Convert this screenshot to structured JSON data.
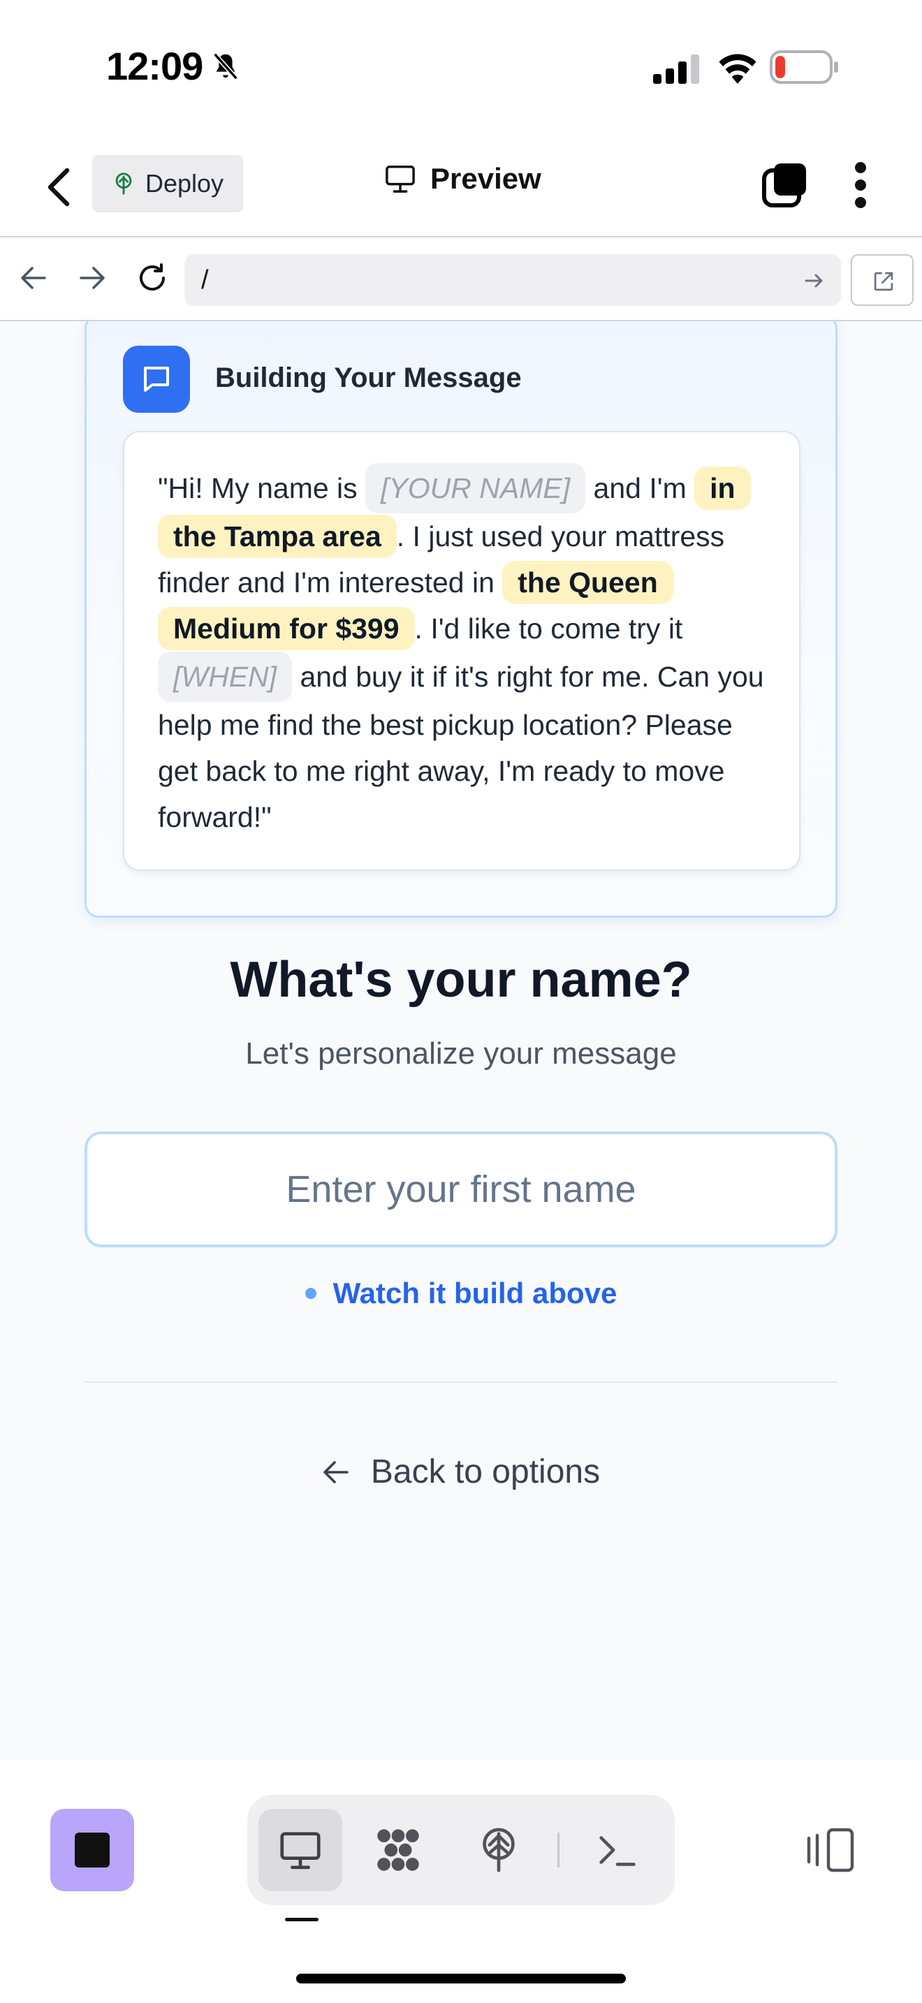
{
  "status_bar": {
    "time": "12:09",
    "battery_level": 0.18
  },
  "header": {
    "deploy_label": "Deploy",
    "title": "Preview"
  },
  "browser": {
    "url": "/"
  },
  "message_card": {
    "title": "Building Your Message",
    "text_1": "\"Hi! My name is ",
    "chip_name": "[YOUR NAME]",
    "text_2": " and I'm ",
    "chip_location": "in the Tampa area",
    "text_3": ". I just used your mattress finder and I'm interested in ",
    "chip_product": "the Queen Medium for $399",
    "text_4": ". I'd like to come try it ",
    "chip_when": "[WHEN]",
    "text_5": " and buy it if it's right for me. Can you help me find the best pickup location? Please get back to me right away, I'm ready to move forward!\""
  },
  "question": {
    "title": "What's your name?",
    "subtitle": "Let's personalize your message",
    "input_placeholder": "Enter your first name",
    "input_value": "",
    "hint": "Watch it build above"
  },
  "back_label": "Back to options",
  "colors": {
    "accent_blue": "#2f6ff2",
    "highlight_yellow": "#fef3c0",
    "stop_purple": "#b9a6fb"
  }
}
